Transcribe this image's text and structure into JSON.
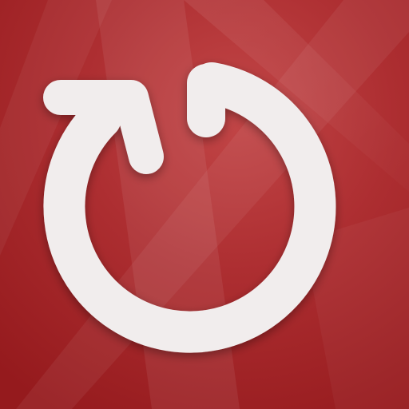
{
  "icon": {
    "name": "refresh-icon",
    "symbol_color": "#f1eded",
    "background_colors": {
      "base": "#9e1c1f",
      "light": "#c4484a",
      "dark": "#8f1618"
    }
  }
}
